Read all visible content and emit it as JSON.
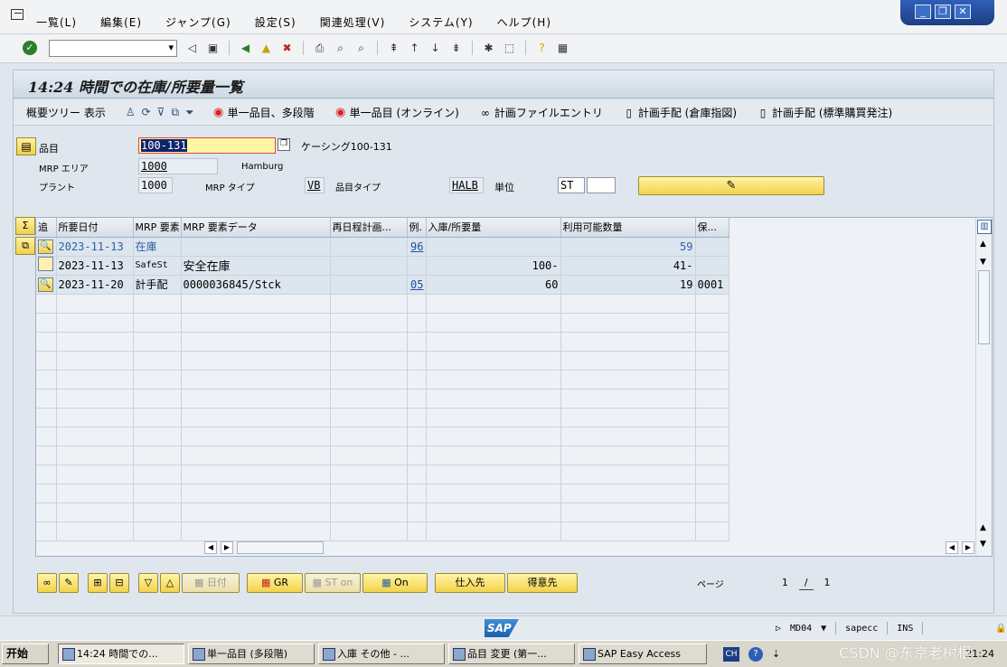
{
  "menu": [
    "一覧(L)",
    "編集(E)",
    "ジャンプ(G)",
    "設定(S)",
    "関連処理(V)",
    "システム(Y)",
    "ヘルプ(H)"
  ],
  "title": "14:24 時間での在庫/所要量一覧",
  "app_toolbar": {
    "overview_tree": "概要ツリー 表示",
    "single_item_multilevel": "単一品目、多段階",
    "single_item_online": "単一品目 (オンライン)",
    "planning_file_entry": "計画ファイルエントリ",
    "plan_order_warehouse": "計画手配 (倉庫指図)",
    "plan_order_standard": "計画手配 (標準購買発注)"
  },
  "header": {
    "material_label": "品目",
    "material_value": "100-131",
    "material_desc": "ケーシング100-131",
    "mrp_area_label": "MRP エリア",
    "mrp_area_value": "1000",
    "mrp_area_desc": "Hamburg",
    "plant_label": "プラント",
    "plant_value": "1000",
    "mrp_type_label": "MRP タイプ",
    "mrp_type_value": "VB",
    "material_type_label": "品目タイプ",
    "material_type_value": "HALB",
    "unit_label": "単位",
    "unit_value": "ST"
  },
  "table": {
    "headers": [
      "追",
      "所要日付",
      "MRP 要素",
      "MRP 要素データ",
      "再日程計画...",
      "例.",
      "入庫/所要量",
      "利用可能数量",
      "保..."
    ],
    "rows": [
      {
        "date": "2023-11-13",
        "element": "在庫",
        "data": "",
        "resched": "",
        "exc": "96",
        "qty": "",
        "avail": "59",
        "stor": ""
      },
      {
        "date": "2023-11-13",
        "element": "SafeSt",
        "data": "安全在庫",
        "resched": "",
        "exc": "",
        "qty": "100-",
        "avail": "41-",
        "stor": ""
      },
      {
        "date": "2023-11-20",
        "element": "計手配",
        "data": "0000036845/Stck",
        "resched": "",
        "exc": "05",
        "qty": "60",
        "avail": "19",
        "stor": "0001"
      }
    ]
  },
  "bottom": {
    "date_label": "日付",
    "gr_label": "GR",
    "st_on_label": "ST on",
    "on_label": "On",
    "vendor_label": "仕入先",
    "customer_label": "得意先",
    "page_label": "ページ",
    "page_current": "1",
    "page_sep": "/",
    "page_total": "1"
  },
  "status": {
    "logo": "SAP",
    "tcode": "MD04",
    "server": "sapecc",
    "mode": "INS"
  },
  "taskbar": {
    "start": "开始",
    "tasks": [
      "14:24 時間での...",
      "単一品目 (多段階)",
      "入庫 その他 - ...",
      "品目 変更 (第一...",
      "SAP Easy Access"
    ],
    "lang": "CH",
    "clock": "21:24"
  },
  "watermark": "CSDN @东京老树根"
}
